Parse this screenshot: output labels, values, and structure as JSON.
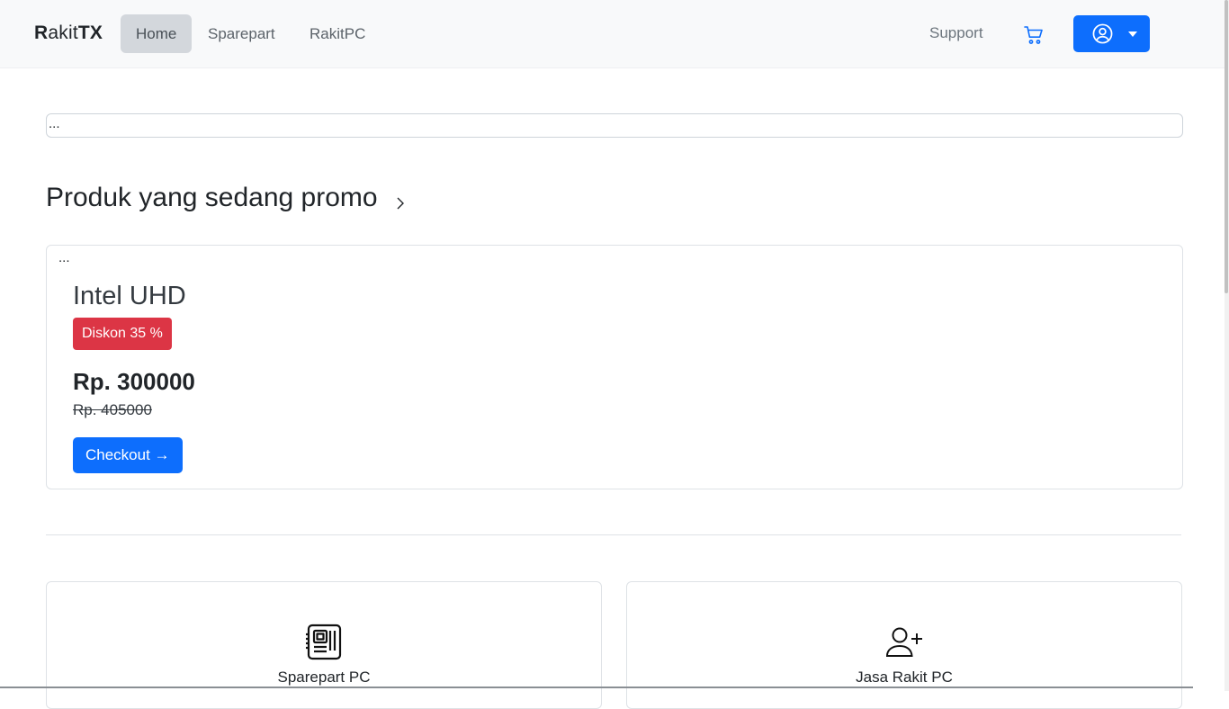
{
  "brand": {
    "bold_part": "R",
    "light_part": "akit",
    "bold_suffix": "TX"
  },
  "nav": {
    "items": [
      {
        "label": "Home",
        "active": true
      },
      {
        "label": "Sparepart",
        "active": false
      },
      {
        "label": "RakitPC",
        "active": false
      }
    ],
    "support_label": "Support",
    "cart_icon": "cart-icon",
    "user_icon": "user-circle-icon",
    "accent_color": "#0d6efd"
  },
  "search": {
    "text": "..."
  },
  "promo": {
    "title": "Produk yang sedang promo",
    "chevron_icon": "chevron-right-icon",
    "card": {
      "dots": "...",
      "product_name": "Intel UHD",
      "discount": "Diskon 35 %",
      "price": "Rp. 300000",
      "old_price": "Rp. 405000",
      "checkout_label": "Checkout →"
    },
    "badge_color": "#dc3545"
  },
  "services": [
    {
      "label": "Sparepart PC",
      "icon": "motherboard-icon"
    },
    {
      "label": "Jasa Rakit PC",
      "icon": "person-plus-icon"
    }
  ]
}
